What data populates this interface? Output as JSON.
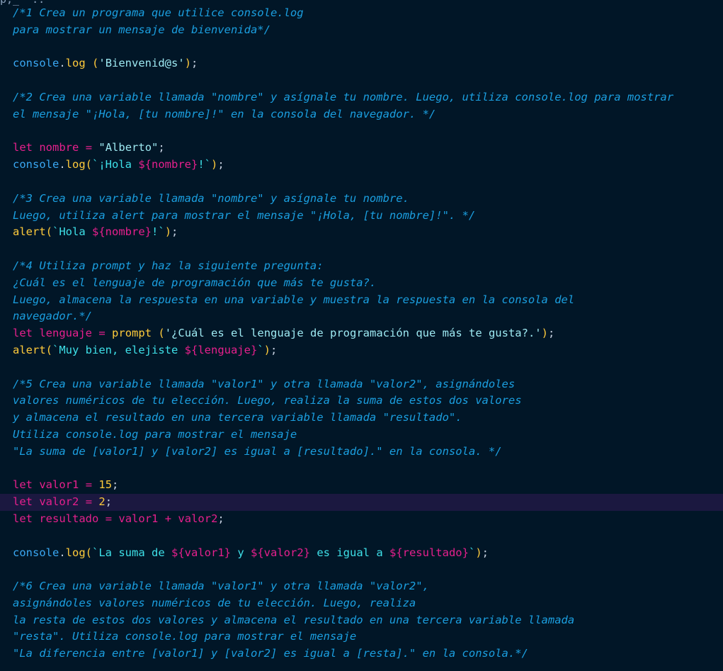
{
  "editor": {
    "top_fragment": "p;_  ..",
    "current_line_index": 29,
    "lines": [
      [
        {
          "c": "cm",
          "t": "/*1 Crea un programa que utilice console.log"
        }
      ],
      [
        {
          "c": "cm",
          "t": "para mostrar un mensaje de bienvenida*/"
        }
      ],
      [],
      [
        {
          "c": "id",
          "t": "console"
        },
        {
          "c": "dot",
          "t": "."
        },
        {
          "c": "fn",
          "t": "log"
        },
        {
          "c": "pn",
          "t": " "
        },
        {
          "c": "par",
          "t": "("
        },
        {
          "c": "str",
          "t": "'Bienvenid@s'"
        },
        {
          "c": "par",
          "t": ")"
        },
        {
          "c": "pn",
          "t": ";"
        }
      ],
      [],
      [
        {
          "c": "cm",
          "t": "/*2 Crea una variable llamada \"nombre\" y asígnale tu nombre. Luego, utiliza console.log para mostrar"
        }
      ],
      [
        {
          "c": "cm",
          "t": "el mensaje \"¡Hola, [tu nombre]!\" en la consola del navegador. */"
        }
      ],
      [],
      [
        {
          "c": "kw",
          "t": "let"
        },
        {
          "c": "pn",
          "t": " "
        },
        {
          "c": "vr",
          "t": "nombre"
        },
        {
          "c": "pn",
          "t": " "
        },
        {
          "c": "op",
          "t": "="
        },
        {
          "c": "pn",
          "t": " "
        },
        {
          "c": "str",
          "t": "\"Alberto\""
        },
        {
          "c": "pn",
          "t": ";"
        }
      ],
      [
        {
          "c": "id",
          "t": "console"
        },
        {
          "c": "dot",
          "t": "."
        },
        {
          "c": "fn",
          "t": "log"
        },
        {
          "c": "par",
          "t": "("
        },
        {
          "c": "tpl",
          "t": "`¡Hola "
        },
        {
          "c": "interp",
          "t": "${nombre}"
        },
        {
          "c": "tpl",
          "t": "!`"
        },
        {
          "c": "par",
          "t": ")"
        },
        {
          "c": "pn",
          "t": ";"
        }
      ],
      [],
      [
        {
          "c": "cm",
          "t": "/*3 Crea una variable llamada \"nombre\" y asígnale tu nombre."
        }
      ],
      [
        {
          "c": "cm",
          "t": "Luego, utiliza alert para mostrar el mensaje \"¡Hola, [tu nombre]!\". */"
        }
      ],
      [
        {
          "c": "fn",
          "t": "alert"
        },
        {
          "c": "par",
          "t": "("
        },
        {
          "c": "tpl",
          "t": "`Hola "
        },
        {
          "c": "interp",
          "t": "${nombre}"
        },
        {
          "c": "tpl",
          "t": "!`"
        },
        {
          "c": "par",
          "t": ")"
        },
        {
          "c": "pn",
          "t": ";"
        }
      ],
      [],
      [
        {
          "c": "cm",
          "t": "/*4 Utiliza prompt y haz la siguiente pregunta:"
        }
      ],
      [
        {
          "c": "cm",
          "t": "¿Cuál es el lenguaje de programación que más te gusta?."
        }
      ],
      [
        {
          "c": "cm",
          "t": "Luego, almacena la respuesta en una variable y muestra la respuesta en la consola del"
        }
      ],
      [
        {
          "c": "cm",
          "t": "navegador.*/"
        }
      ],
      [
        {
          "c": "kw",
          "t": "let"
        },
        {
          "c": "pn",
          "t": " "
        },
        {
          "c": "vr",
          "t": "lenguaje"
        },
        {
          "c": "pn",
          "t": " "
        },
        {
          "c": "op",
          "t": "="
        },
        {
          "c": "pn",
          "t": " "
        },
        {
          "c": "fn",
          "t": "prompt"
        },
        {
          "c": "pn",
          "t": " "
        },
        {
          "c": "par",
          "t": "("
        },
        {
          "c": "str",
          "t": "'¿Cuál es el lenguaje de programación que más te gusta?.'"
        },
        {
          "c": "par",
          "t": ")"
        },
        {
          "c": "pn",
          "t": ";"
        }
      ],
      [
        {
          "c": "fn",
          "t": "alert"
        },
        {
          "c": "par",
          "t": "("
        },
        {
          "c": "tpl",
          "t": "`Muy bien, elejiste "
        },
        {
          "c": "interp",
          "t": "${lenguaje}"
        },
        {
          "c": "tpl",
          "t": "`"
        },
        {
          "c": "par",
          "t": ")"
        },
        {
          "c": "pn",
          "t": ";"
        }
      ],
      [],
      [
        {
          "c": "cm",
          "t": "/*5 Crea una variable llamada \"valor1\" y otra llamada \"valor2\", asignándoles"
        }
      ],
      [
        {
          "c": "cm",
          "t": "valores numéricos de tu elección. Luego, realiza la suma de estos dos valores"
        }
      ],
      [
        {
          "c": "cm",
          "t": "y almacena el resultado en una tercera variable llamada \"resultado\"."
        }
      ],
      [
        {
          "c": "cm",
          "t": "Utiliza console.log para mostrar el mensaje"
        }
      ],
      [
        {
          "c": "cm",
          "t": "\"La suma de [valor1] y [valor2] es igual a [resultado].\" en la consola. */"
        }
      ],
      [],
      [
        {
          "c": "kw",
          "t": "let"
        },
        {
          "c": "pn",
          "t": " "
        },
        {
          "c": "vr",
          "t": "valor1"
        },
        {
          "c": "pn",
          "t": " "
        },
        {
          "c": "op",
          "t": "="
        },
        {
          "c": "pn",
          "t": " "
        },
        {
          "c": "num",
          "t": "15"
        },
        {
          "c": "pn",
          "t": ";"
        }
      ],
      [
        {
          "c": "kw",
          "t": "let"
        },
        {
          "c": "pn",
          "t": " "
        },
        {
          "c": "vr",
          "t": "valor2"
        },
        {
          "c": "pn",
          "t": " "
        },
        {
          "c": "op",
          "t": "="
        },
        {
          "c": "pn",
          "t": " "
        },
        {
          "c": "num",
          "t": "2"
        },
        {
          "c": "pn",
          "t": ";"
        }
      ],
      [
        {
          "c": "kw",
          "t": "let"
        },
        {
          "c": "pn",
          "t": " "
        },
        {
          "c": "vr",
          "t": "resultado"
        },
        {
          "c": "pn",
          "t": " "
        },
        {
          "c": "op",
          "t": "="
        },
        {
          "c": "pn",
          "t": " "
        },
        {
          "c": "vr",
          "t": "valor1"
        },
        {
          "c": "pn",
          "t": " "
        },
        {
          "c": "op",
          "t": "+"
        },
        {
          "c": "pn",
          "t": " "
        },
        {
          "c": "vr",
          "t": "valor2"
        },
        {
          "c": "pn",
          "t": ";"
        }
      ],
      [],
      [
        {
          "c": "id",
          "t": "console"
        },
        {
          "c": "dot",
          "t": "."
        },
        {
          "c": "fn",
          "t": "log"
        },
        {
          "c": "par",
          "t": "("
        },
        {
          "c": "tpl",
          "t": "`La suma de "
        },
        {
          "c": "interp",
          "t": "${valor1}"
        },
        {
          "c": "tpl",
          "t": " y "
        },
        {
          "c": "interp",
          "t": "${valor2}"
        },
        {
          "c": "tpl",
          "t": " es igual a "
        },
        {
          "c": "interp",
          "t": "${resultado}"
        },
        {
          "c": "tpl",
          "t": "`"
        },
        {
          "c": "par",
          "t": ")"
        },
        {
          "c": "pn",
          "t": ";"
        }
      ],
      [],
      [
        {
          "c": "cm",
          "t": "/*6 Crea una variable llamada \"valor1\" y otra llamada \"valor2\","
        }
      ],
      [
        {
          "c": "cm",
          "t": "asignándoles valores numéricos de tu elección. Luego, realiza"
        }
      ],
      [
        {
          "c": "cm",
          "t": "la resta de estos dos valores y almacena el resultado en una tercera variable llamada"
        }
      ],
      [
        {
          "c": "cm",
          "t": "\"resta\". Utiliza console.log para mostrar el mensaje"
        }
      ],
      [
        {
          "c": "cm",
          "t": "\"La diferencia entre [valor1] y [valor2] es igual a [resta].\" en la consola.*/"
        }
      ]
    ]
  },
  "colors": {
    "background": "#011627",
    "current_line": "#1b1840",
    "comment": "#1b9fe0",
    "keyword": "#e6208d",
    "function": "#ffcb3b",
    "string": "#9ee9f2",
    "template": "#3ee0e8"
  }
}
